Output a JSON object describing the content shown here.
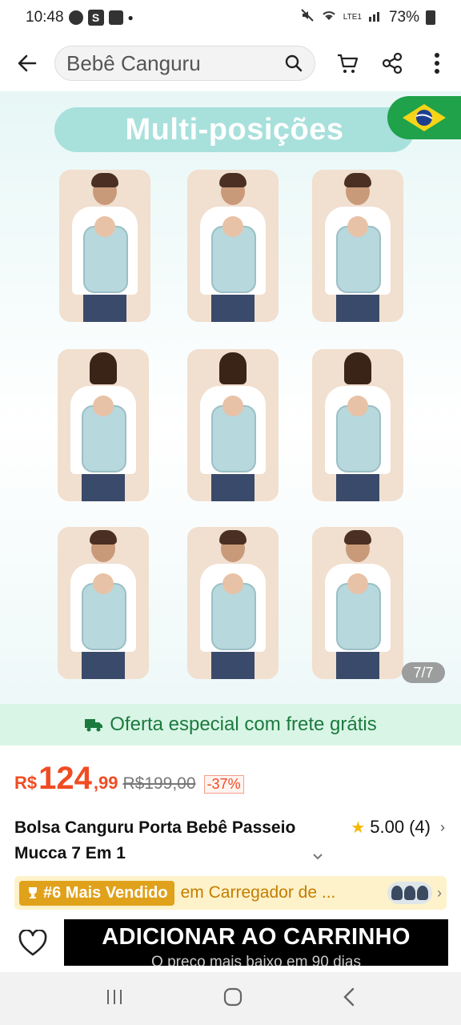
{
  "status_bar": {
    "time": "10:48",
    "battery": "73%",
    "net_label": "LTE1"
  },
  "search": {
    "query": "Bebê Canguru"
  },
  "hero": {
    "banner_title": "Multi-posições",
    "image_counter": "7/7"
  },
  "shipping": {
    "text": "Oferta especial com frete grátis"
  },
  "price": {
    "currency": "R$",
    "integer": "124",
    "decimal": ",99",
    "original": "R$199,00",
    "discount": "-37%"
  },
  "product": {
    "title": "Bolsa Canguru Porta Bebê Passeio Mucca 7 Em 1",
    "rating": "5.00",
    "reviews": "(4)"
  },
  "bestseller": {
    "rank": "#6 Mais Vendido",
    "category": "em Carregador de ..."
  },
  "actions": {
    "add_to_cart": "ADICIONAR AO CARRINHO",
    "add_to_cart_sub": "O preço mais baixo em 90 dias"
  },
  "icons": {
    "back": "arrow-left-icon",
    "search": "search-icon",
    "cart": "cart-icon",
    "share": "share-icon",
    "more": "more-vertical-icon",
    "truck": "truck-icon",
    "star": "star-icon",
    "heart": "heart-icon",
    "trophy": "trophy-icon"
  },
  "colors": {
    "accent": "#f04c23",
    "shipping_green": "#1b7a3e",
    "banner_teal": "#a8e0dc",
    "bestseller_gold": "#e0a11b"
  }
}
